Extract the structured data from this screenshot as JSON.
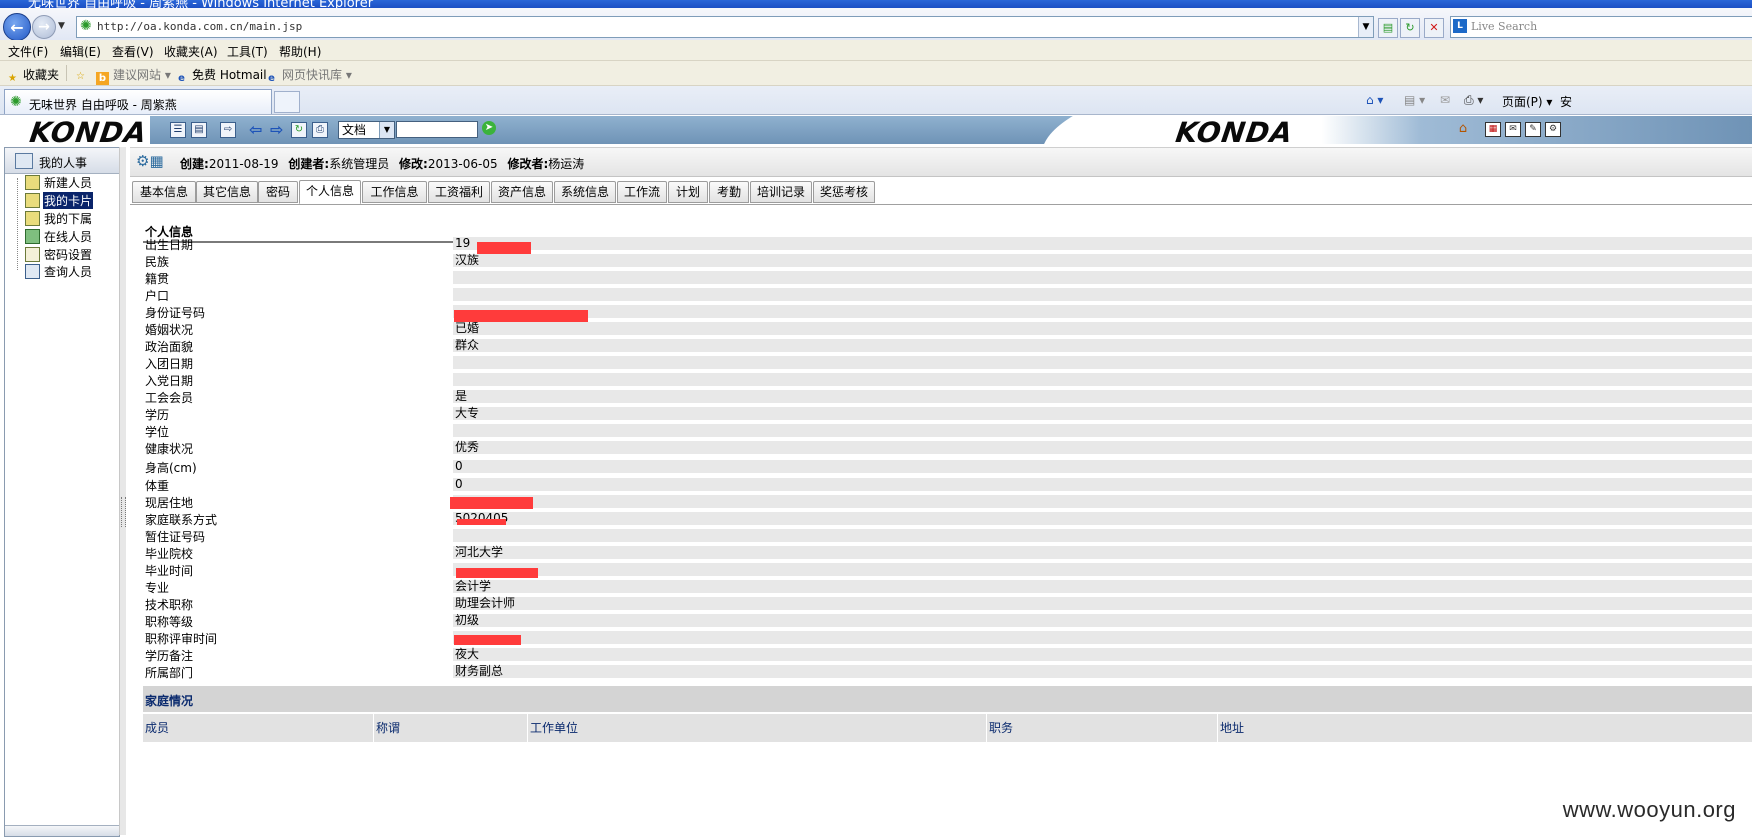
{
  "browser": {
    "window_title": "无味世界 自由呼吸 - 周紫燕 - Windows Internet Explorer",
    "url": "http://oa.konda.com.cn/main.jsp",
    "search_placeholder": "Live Search",
    "tab_title": "无味世界 自由呼吸 - 周紫燕",
    "menu": [
      "文件(F)",
      "编辑(E)",
      "查看(V)",
      "收藏夹(A)",
      "工具(T)",
      "帮助(H)"
    ],
    "favorites": {
      "label": "收藏夹",
      "items": [
        "建议网站 ▾",
        "免费 Hotmail",
        "网页快讯库 ▾"
      ]
    },
    "command_bar": {
      "page_label": "页面(P) ▾",
      "safety_label": "安"
    }
  },
  "app": {
    "logo_text": "KONDA",
    "doc_select_value": "文档",
    "sidebar": {
      "header": "我的人事",
      "items": [
        {
          "label": "新建人员",
          "selected": false
        },
        {
          "label": "我的卡片",
          "selected": true
        },
        {
          "label": "我的下属",
          "selected": false
        },
        {
          "label": "在线人员",
          "selected": false
        },
        {
          "label": "密码设置",
          "selected": false
        },
        {
          "label": "查询人员",
          "selected": false
        }
      ]
    },
    "record_info": {
      "created_label": "创建:",
      "created_value": "2011-08-19",
      "creator_label": "创建者:",
      "creator_value": "系统管理员",
      "modified_label": "修改:",
      "modified_value": "2013-06-05",
      "modifier_label": "修改者:",
      "modifier_value": "杨运涛"
    },
    "tabs": [
      "基本信息",
      "其它信息",
      "密码",
      "个人信息",
      "工作信息",
      "工资福利",
      "资产信息",
      "系统信息",
      "工作流",
      "计划",
      "考勤",
      "培训记录",
      "奖惩考核"
    ],
    "active_tab": "个人信息",
    "section_title": "个人信息",
    "fields": [
      {
        "label": "出生日期",
        "value": "19"
      },
      {
        "label": "民族",
        "value": "汉族"
      },
      {
        "label": "籍贯",
        "value": ""
      },
      {
        "label": "户口",
        "value": ""
      },
      {
        "label": "身份证号码",
        "value": ""
      },
      {
        "label": "婚姻状况",
        "value": "已婚"
      },
      {
        "label": "政治面貌",
        "value": "群众"
      },
      {
        "label": "入团日期",
        "value": ""
      },
      {
        "label": "入党日期",
        "value": ""
      },
      {
        "label": "工会会员",
        "value": "是"
      },
      {
        "label": "学历",
        "value": "大专"
      },
      {
        "label": "学位",
        "value": ""
      },
      {
        "label": "健康状况",
        "value": "优秀"
      },
      {
        "label": "身高(cm)",
        "value": "0"
      },
      {
        "label": "体重",
        "value": "0"
      },
      {
        "label": "现居住地",
        "value": ""
      },
      {
        "label": "家庭联系方式",
        "value": "5020405"
      },
      {
        "label": "暂住证号码",
        "value": ""
      },
      {
        "label": "毕业院校",
        "value": "河北大学"
      },
      {
        "label": "毕业时间",
        "value": ""
      },
      {
        "label": "专业",
        "value": "会计学"
      },
      {
        "label": "技术职称",
        "value": "助理会计师"
      },
      {
        "label": "职称等级",
        "value": "初级"
      },
      {
        "label": "职称评审时间",
        "value": ""
      },
      {
        "label": "学历备注",
        "value": "夜大"
      },
      {
        "label": "所属部门",
        "value": "财务副总"
      }
    ],
    "family_title": "家庭情况",
    "family_columns": [
      "成员",
      "称谓",
      "工作单位",
      "职务",
      "地址"
    ]
  },
  "watermark": "www.wooyun.org",
  "colors": {
    "title_bar": "#1b4fc4",
    "toolbar_band": "#6f93b6",
    "selected_item": "#0a246a",
    "redaction": "#ff3b3b",
    "field_bg": "#e8e8e8"
  }
}
